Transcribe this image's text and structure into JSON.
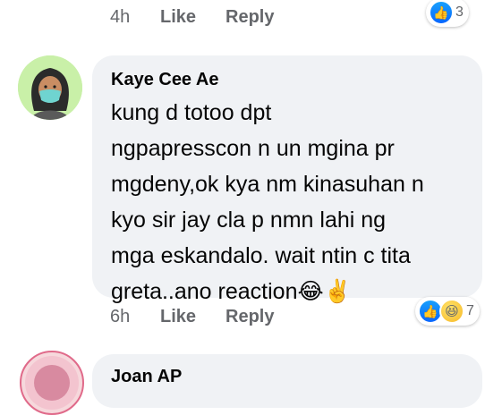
{
  "comments": [
    {
      "time": "4h",
      "like_label": "Like",
      "reply_label": "Reply",
      "reactions": {
        "icons": [
          "like-icon"
        ],
        "count": "3"
      }
    },
    {
      "author": "Kaye Cee Ae",
      "text": "kung d totoo dpt\nngpapresscon n un mgina pr\nmgdeny,ok kya nm kinasuhan n\nkyo sir jay  cla p nmn lahi ng\nmga eskandalo. wait ntin c tita\ngreta..ano reaction",
      "text_emojis": [
        "😂",
        "✌️"
      ],
      "time": "6h",
      "like_label": "Like",
      "reply_label": "Reply",
      "reactions": {
        "icons": [
          "like-icon",
          "haha-icon"
        ],
        "count": "7"
      }
    },
    {
      "author": "Joan AP"
    }
  ],
  "colors": {
    "bubble": "#f0f2f5",
    "meta_text": "#65676b",
    "like_blue": "#0866ff",
    "haha_yellow": "#f7b928"
  }
}
